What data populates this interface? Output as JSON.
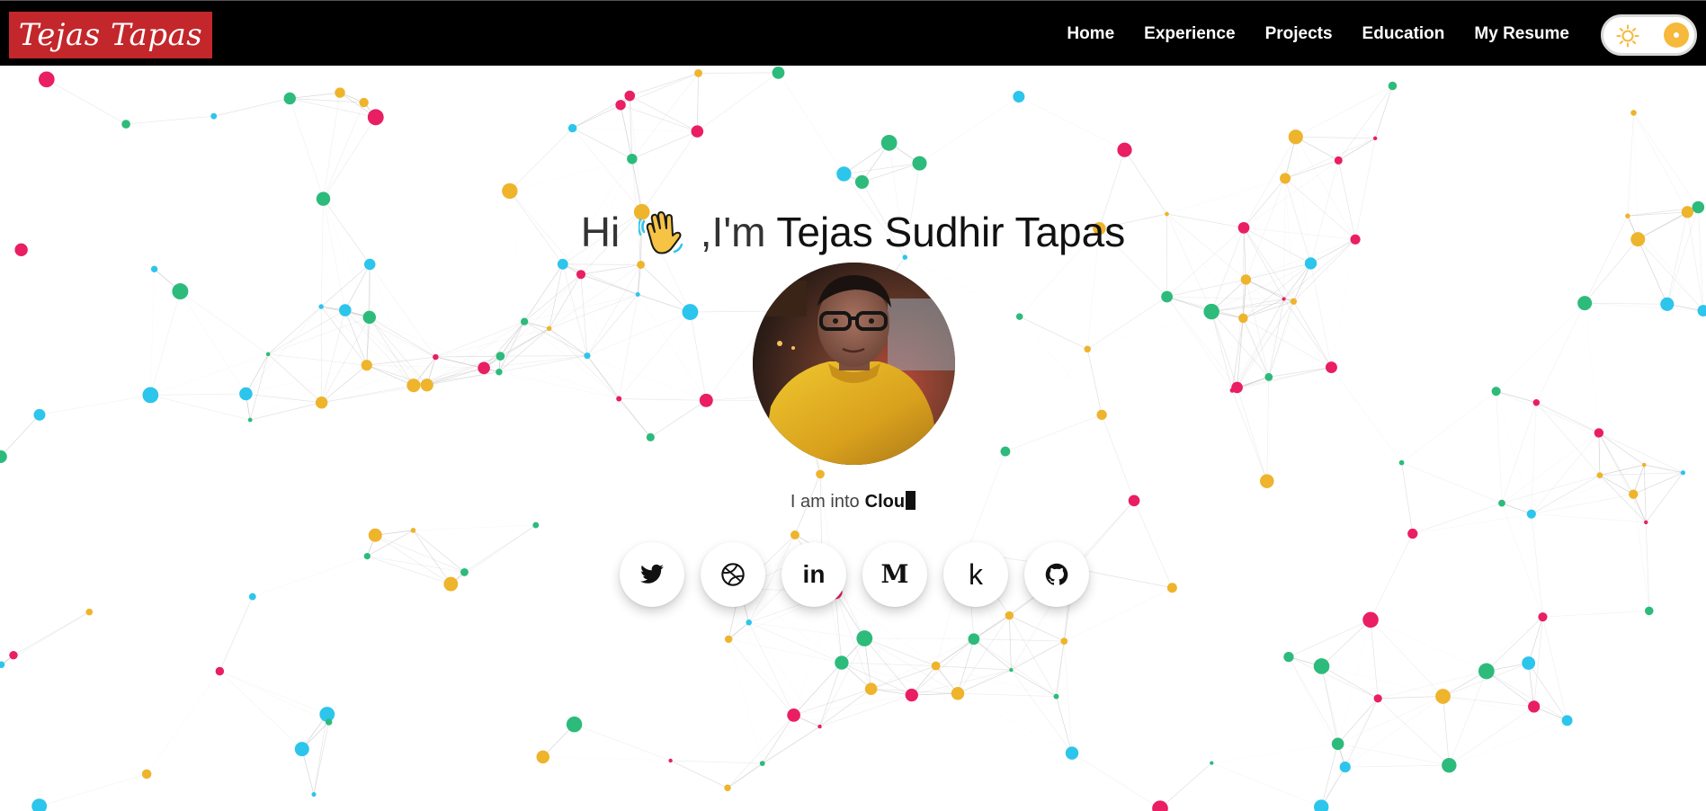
{
  "brand": {
    "logo_text": "Tejas Tapas"
  },
  "nav": {
    "links": [
      "Home",
      "Experience",
      "Projects",
      "Education",
      "My Resume"
    ]
  },
  "theme_toggle": {
    "sun_color": "#f6b93b",
    "knob_color": "#f6b93b"
  },
  "hero": {
    "greeting_prefix": "Hi",
    "greeting_mid": ",I'm",
    "name": "Tejas Sudhir Tapas",
    "tagline_prefix": "I am into",
    "tagline_typed": "Clou"
  },
  "socials": [
    {
      "icon": "twitter-icon"
    },
    {
      "icon": "dribbble-icon"
    },
    {
      "icon": "linkedin-icon",
      "glyph": "in"
    },
    {
      "icon": "medium-icon",
      "glyph": "M"
    },
    {
      "icon": "kaggle-icon",
      "glyph": "k"
    },
    {
      "icon": "github-icon"
    }
  ],
  "colors": {
    "navbar_bg": "#000000",
    "brand_bg": "#c3272b",
    "particle_colors": [
      "#e91e63",
      "#2dbb7b",
      "#eeb42c",
      "#2cc5eb"
    ]
  }
}
